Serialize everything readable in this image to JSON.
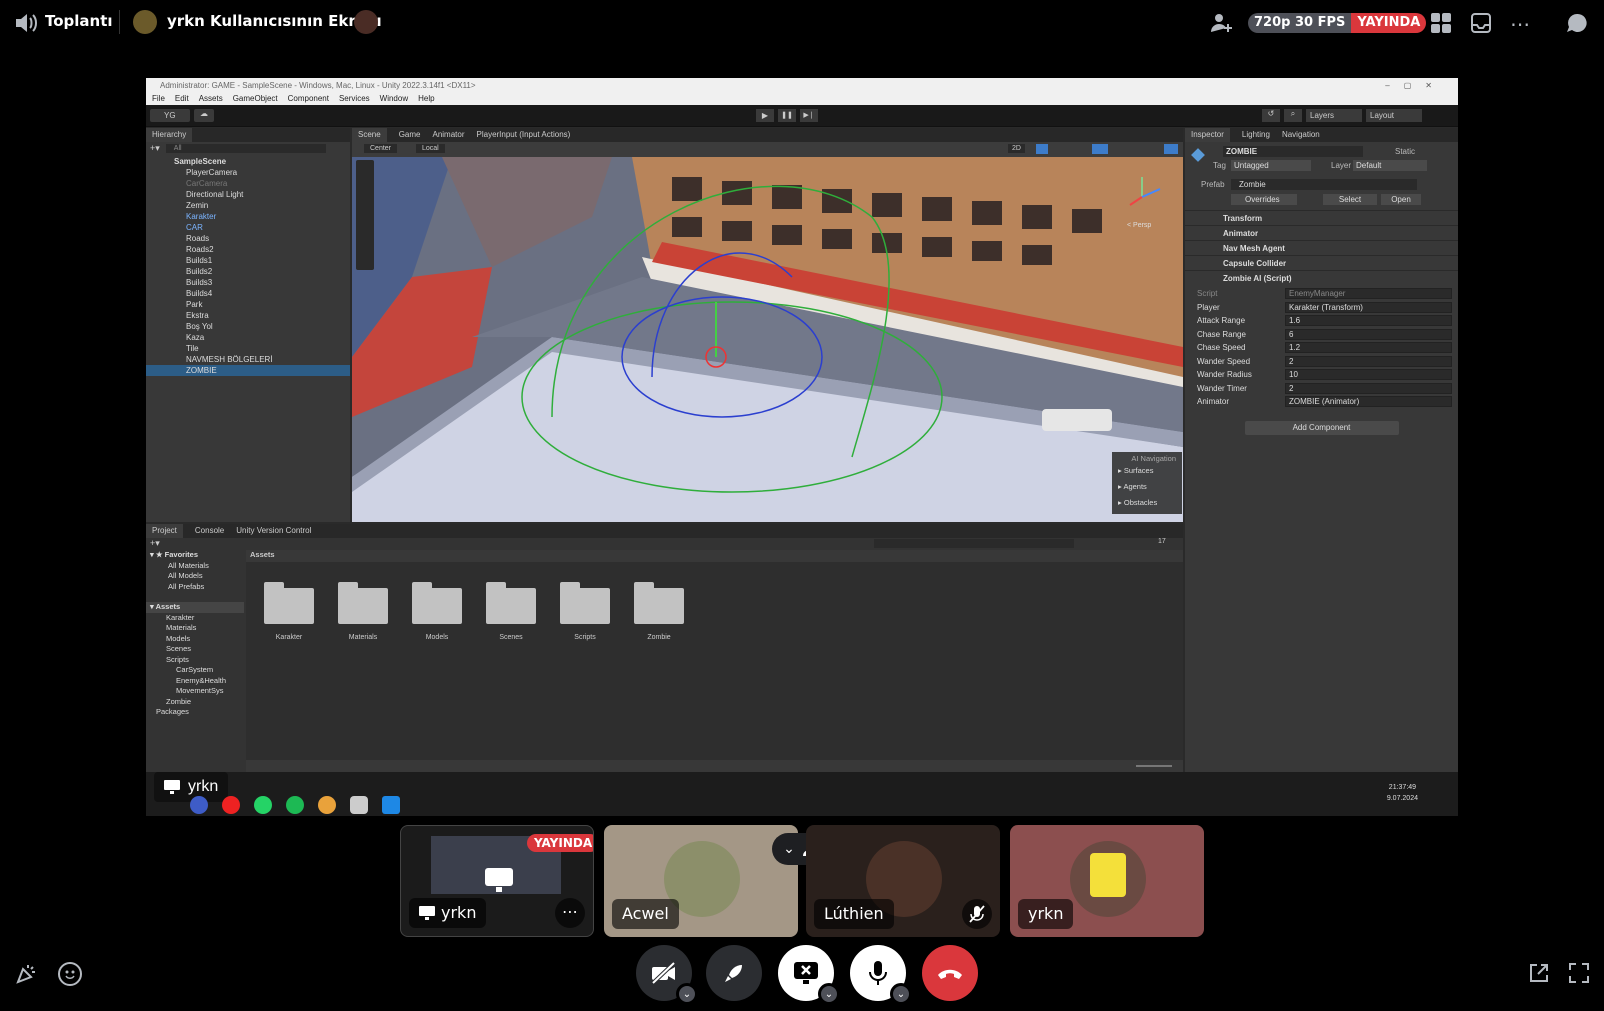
{
  "topbar": {
    "channel": "Toplantı",
    "stream_title": "yrkn Kullanıcısının Ekranı",
    "quality": "720p 30 FPS",
    "live": "YAYINDA"
  },
  "unity": {
    "window_title": "Administrator: GAME - SampleScene - Windows, Mac, Linux - Unity 2022.3.14f1 <DX11>",
    "menu": [
      "File",
      "Edit",
      "Assets",
      "GameObject",
      "Component",
      "Services",
      "Window",
      "Help"
    ],
    "account": "YG",
    "layers": "Layers",
    "layout": "Layout",
    "hierarchy_tab": "Hierarchy",
    "hierarchy_search": "All",
    "hierarchy": [
      {
        "name": "SampleScene",
        "indent": 0,
        "style": "bold"
      },
      {
        "name": "PlayerCamera",
        "indent": 1,
        "style": ""
      },
      {
        "name": "CarCamera",
        "indent": 1,
        "style": "grey"
      },
      {
        "name": "Directional Light",
        "indent": 1,
        "style": ""
      },
      {
        "name": "Zemin",
        "indent": 1,
        "style": ""
      },
      {
        "name": "Karakter",
        "indent": 1,
        "style": "blue"
      },
      {
        "name": "CAR",
        "indent": 1,
        "style": "blue"
      },
      {
        "name": "Roads",
        "indent": 1,
        "style": ""
      },
      {
        "name": "Roads2",
        "indent": 1,
        "style": ""
      },
      {
        "name": "Builds1",
        "indent": 1,
        "style": ""
      },
      {
        "name": "Builds2",
        "indent": 1,
        "style": ""
      },
      {
        "name": "Builds3",
        "indent": 1,
        "style": ""
      },
      {
        "name": "Builds4",
        "indent": 1,
        "style": ""
      },
      {
        "name": "Park",
        "indent": 1,
        "style": ""
      },
      {
        "name": "Ekstra",
        "indent": 1,
        "style": ""
      },
      {
        "name": "Boş Yol",
        "indent": 1,
        "style": ""
      },
      {
        "name": "Kaza",
        "indent": 1,
        "style": ""
      },
      {
        "name": "Tile",
        "indent": 1,
        "style": ""
      },
      {
        "name": "NAVMESH BÖLGELERİ",
        "indent": 1,
        "style": ""
      },
      {
        "name": "ZOMBIE",
        "indent": 1,
        "style": "sel"
      }
    ],
    "scene_tabs": [
      "Scene",
      "Game",
      "Animator",
      "PlayerInput (Input Actions)"
    ],
    "scene_toolbar": {
      "pivot": "Center",
      "space": "Local",
      "mode2d": "2D"
    },
    "persp": "< Persp",
    "ai_nav": {
      "title": "AI Navigation",
      "items": [
        "Surfaces",
        "Agents",
        "Obstacles"
      ]
    },
    "inspector_tabs": [
      "Inspector",
      "Lighting",
      "Navigation"
    ],
    "object_name": "ZOMBIE",
    "static": "Static",
    "tag_label": "Tag",
    "tag": "Untagged",
    "layer_label": "Layer",
    "layer": "Default",
    "prefab_label": "Prefab",
    "prefab": "Zombie",
    "overrides": "Overrides",
    "select": "Select",
    "open": "Open",
    "components": [
      "Transform",
      "Animator",
      "Nav Mesh Agent",
      "Capsule Collider",
      "Zombie AI (Script)"
    ],
    "fields": [
      {
        "label": "Script",
        "value": "EnemyManager"
      },
      {
        "label": "Player",
        "value": "Karakter (Transform)"
      },
      {
        "label": "Attack Range",
        "value": "1.6"
      },
      {
        "label": "Chase Range",
        "value": "6"
      },
      {
        "label": "Chase Speed",
        "value": "1.2"
      },
      {
        "label": "Wander Speed",
        "value": "2"
      },
      {
        "label": "Wander Radius",
        "value": "10"
      },
      {
        "label": "Wander Timer",
        "value": "2"
      },
      {
        "label": "Animator",
        "value": "ZOMBIE (Animator)"
      }
    ],
    "add_component": "Add Component",
    "bottom_tabs": [
      "Project",
      "Console",
      "Unity Version Control"
    ],
    "favorites": {
      "title": "Favorites",
      "items": [
        "All Materials",
        "All Models",
        "All Prefabs"
      ]
    },
    "assets_tree": {
      "title": "Assets",
      "items": [
        "Karakter",
        "Materials",
        "Models",
        "Scenes",
        "Scripts"
      ],
      "scripts_children": [
        "CarSystem",
        "Enemy&Health",
        "MovementSys"
      ],
      "after": [
        "Zombie"
      ],
      "packages": "Packages"
    },
    "assets_header": "Assets",
    "folders": [
      "Karakter",
      "Materials",
      "Models",
      "Scenes",
      "Scripts",
      "Zombie"
    ],
    "asset_count": "17",
    "clock": {
      "time": "21:37:49",
      "date": "9.07.2024"
    },
    "presenter": "yrkn"
  },
  "participants": [
    {
      "name": "yrkn",
      "badge": "YAYINDA"
    },
    {
      "name": "Acwel"
    },
    {
      "name": "Lúthien"
    },
    {
      "name": "yrkn"
    }
  ]
}
